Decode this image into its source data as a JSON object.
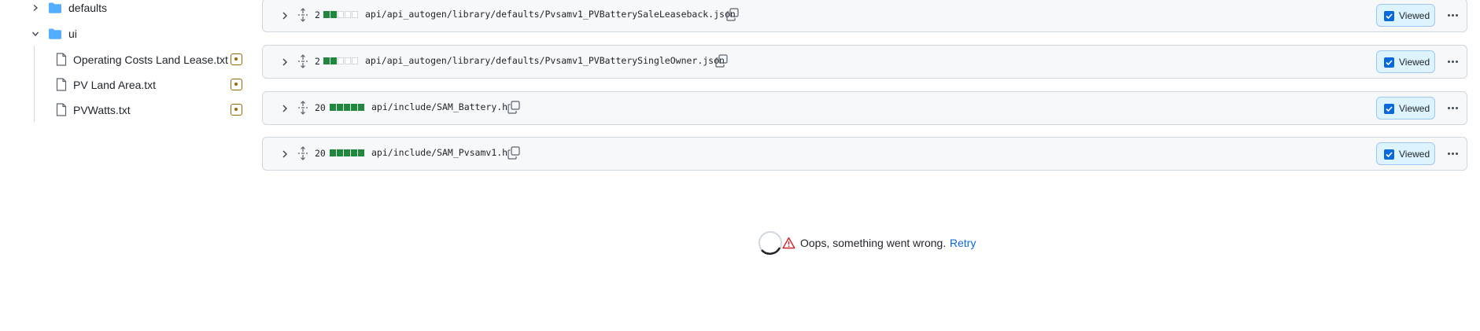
{
  "tree": {
    "items": [
      {
        "label": "defaults",
        "kind": "folder",
        "expanded": false
      },
      {
        "label": "ui",
        "kind": "folder",
        "expanded": true
      },
      {
        "label": "Operating Costs Land Lease.txt",
        "kind": "file",
        "modified": true
      },
      {
        "label": "PV Land Area.txt",
        "kind": "file",
        "modified": true
      },
      {
        "label": "PVWatts.txt",
        "kind": "file",
        "modified": true
      }
    ]
  },
  "diffs": [
    {
      "count": "2",
      "additions_blocks": 2,
      "neutral_blocks": 3,
      "path": "api/api_autogen/library/defaults/Pvsamv1_PVBatterySaleLeaseback.json",
      "viewed_label": "Viewed",
      "viewed": true
    },
    {
      "count": "2",
      "additions_blocks": 2,
      "neutral_blocks": 3,
      "path": "api/api_autogen/library/defaults/Pvsamv1_PVBatterySingleOwner.json",
      "viewed_label": "Viewed",
      "viewed": true
    },
    {
      "count": "20",
      "additions_blocks": 5,
      "neutral_blocks": 0,
      "path": "api/include/SAM_Battery.h",
      "viewed_label": "Viewed",
      "viewed": true
    },
    {
      "count": "20",
      "additions_blocks": 5,
      "neutral_blocks": 0,
      "path": "api/include/SAM_Pvsamv1.h",
      "viewed_label": "Viewed",
      "viewed": true
    }
  ],
  "error": {
    "message": "Oops, something went wrong.",
    "retry_label": "Retry"
  },
  "colors": {
    "accent": "#0969da",
    "addition": "#1f883d",
    "modified": "#9a6700",
    "danger": "#cf222e",
    "folder": "#54aeff"
  }
}
